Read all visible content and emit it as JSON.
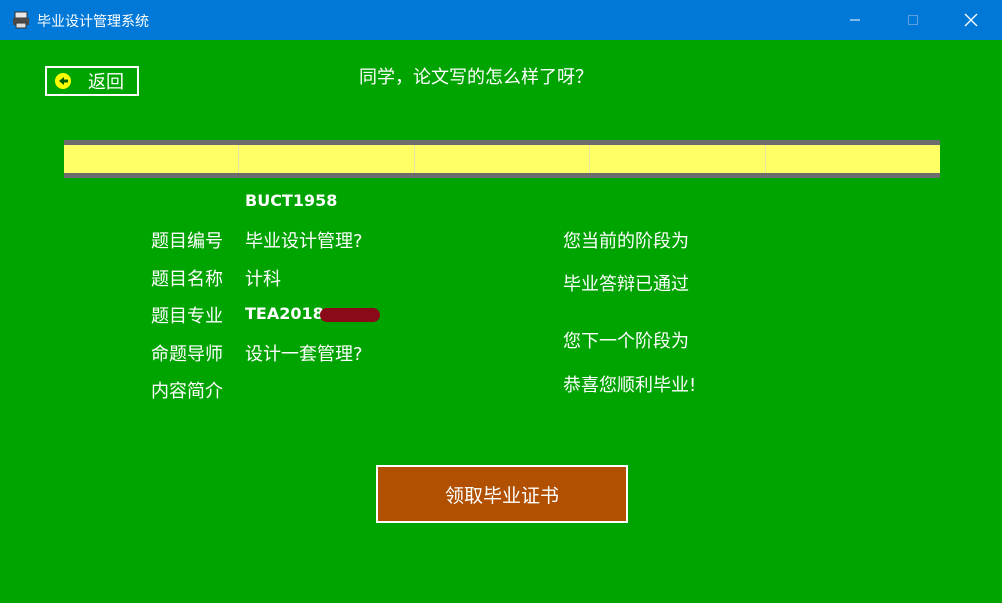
{
  "window": {
    "title": "毕业设计管理系统",
    "icons": {
      "app": "printer-icon",
      "minimize": "minimize-icon",
      "maximize": "maximize-icon",
      "close": "close-icon"
    }
  },
  "nav": {
    "back_label": "返回",
    "back_icon": "arrow-left-circle-icon"
  },
  "header": {
    "title": "同学，论文写的怎么样了呀？"
  },
  "topic": {
    "code": "BUCT1958",
    "labels": {
      "code": "题目编号",
      "name": "题目名称",
      "major": "题目专业",
      "advisor": "命题导师",
      "description": "内容简介"
    },
    "name": "毕业设计管理?",
    "major": "计科",
    "advisor": "TEA2018",
    "description": "设计一套管理?"
  },
  "status": {
    "current_label": "您当前的阶段为",
    "current_value": "毕业答辩已通过",
    "next_label": "您下一个阶段为",
    "next_value": "恭喜您顺利毕业!"
  },
  "actions": {
    "certificate_label": "领取毕业证书"
  },
  "colors": {
    "background": "#00a400",
    "titlebar": "#0078d7",
    "table_band": "#ffff66",
    "button": "#b05000"
  }
}
